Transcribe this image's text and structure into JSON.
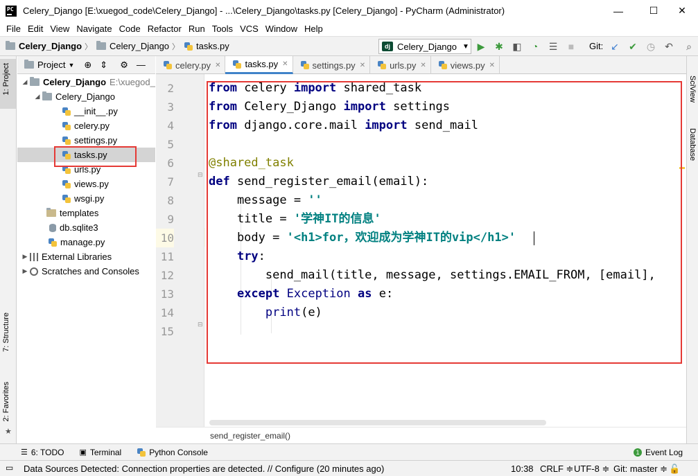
{
  "window": {
    "title": "Celery_Django [E:\\xuegod_code\\Celery_Django] - ...\\Celery_Django\\tasks.py [Celery_Django] - PyCharm (Administrator)",
    "minimize": "—",
    "maximize": "☐",
    "close": "✕"
  },
  "menu": [
    "File",
    "Edit",
    "View",
    "Navigate",
    "Code",
    "Refactor",
    "Run",
    "Tools",
    "VCS",
    "Window",
    "Help"
  ],
  "nav": {
    "crumbs": [
      "Celery_Django",
      "Celery_Django",
      "tasks.py"
    ],
    "run_config": "Celery_Django",
    "git_label": "Git:"
  },
  "left_tabs": {
    "project": "1: Project",
    "structure": "7: Structure",
    "favorites": "2: Favorites"
  },
  "right_tabs": {
    "sciview": "SciView",
    "database": "Database"
  },
  "project_panel": {
    "title": "Project",
    "root": "Celery_Django",
    "root_path": "E:\\xuegod_",
    "package": "Celery_Django",
    "files": [
      "__init__.py",
      "celery.py",
      "settings.py",
      "tasks.py",
      "urls.py",
      "views.py",
      "wsgi.py"
    ],
    "templates": "templates",
    "db": "db.sqlite3",
    "manage": "manage.py",
    "external": "External Libraries",
    "scratches": "Scratches and Consoles"
  },
  "editor_tabs": [
    "celery.py",
    "tasks.py",
    "settings.py",
    "urls.py",
    "views.py"
  ],
  "line_numbers": [
    "2",
    "3",
    "4",
    "5",
    "6",
    "7",
    "8",
    "9",
    "10",
    "11",
    "12",
    "13",
    "14",
    "15"
  ],
  "code": {
    "l2": [
      "from",
      " celery ",
      "import",
      " shared_task"
    ],
    "l3": [
      "from",
      " Celery_Django ",
      "import",
      " settings"
    ],
    "l4": [
      "from",
      " django.core.mail ",
      "import",
      " send_mail"
    ],
    "l6": "@shared_task",
    "l7": [
      "def",
      " send_register_email(email):"
    ],
    "l8": [
      "    message = ",
      "''"
    ],
    "l9": [
      "    title = ",
      "'学神IT的信息'"
    ],
    "l10": [
      "    body = ",
      "'<h1>for，欢迎成为学神IT的vip</h1>'"
    ],
    "l11": [
      "    ",
      "try",
      ":"
    ],
    "l12": "        send_mail(title, message, settings.EMAIL_FROM, [email],",
    "l13": [
      "    ",
      "except",
      " ",
      "Exception",
      " ",
      "as",
      " e:"
    ],
    "l14": [
      "        ",
      "print",
      "(e)"
    ]
  },
  "function_breadcrumb": "send_register_email()",
  "bottom_tools": {
    "todo": "6: TODO",
    "terminal": "Terminal",
    "python_console": "Python Console",
    "event_log": "Event Log"
  },
  "status": {
    "message": "Data Sources Detected: Connection properties are detected. // Configure (20 minutes ago)",
    "position": "10:38",
    "line_sep": "CRLF ≑",
    "encoding": "UTF-8 ≑",
    "git": "Git: master ≑"
  },
  "colors": {
    "highlight_box": "#e53935",
    "keyword": "#000080",
    "string": "#008080",
    "decorator": "#808000"
  }
}
